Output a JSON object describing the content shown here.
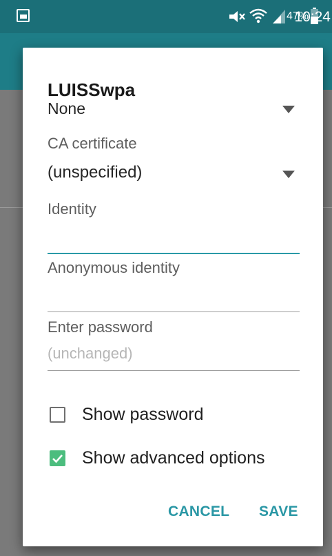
{
  "status_bar": {
    "battery": "47%",
    "time": "10:24"
  },
  "dialog": {
    "title": "LUISSwpa",
    "phase2_value": "None",
    "ca_certificate": {
      "label": "CA certificate",
      "value": "(unspecified)"
    },
    "identity": {
      "label": "Identity",
      "value": ""
    },
    "anonymous_identity": {
      "label": "Anonymous identity",
      "value": ""
    },
    "password": {
      "label": "Enter password",
      "placeholder": "(unchanged)"
    },
    "show_password": {
      "label": "Show password",
      "checked": false
    },
    "show_advanced": {
      "label": "Show advanced options",
      "checked": true
    },
    "buttons": {
      "cancel": "CANCEL",
      "save": "SAVE"
    }
  },
  "colors": {
    "accent": "#2a97a5",
    "checkbox_checked": "#4cbd7e",
    "status_bar": "#1b6f78",
    "app_bar": "#1e7d87"
  }
}
